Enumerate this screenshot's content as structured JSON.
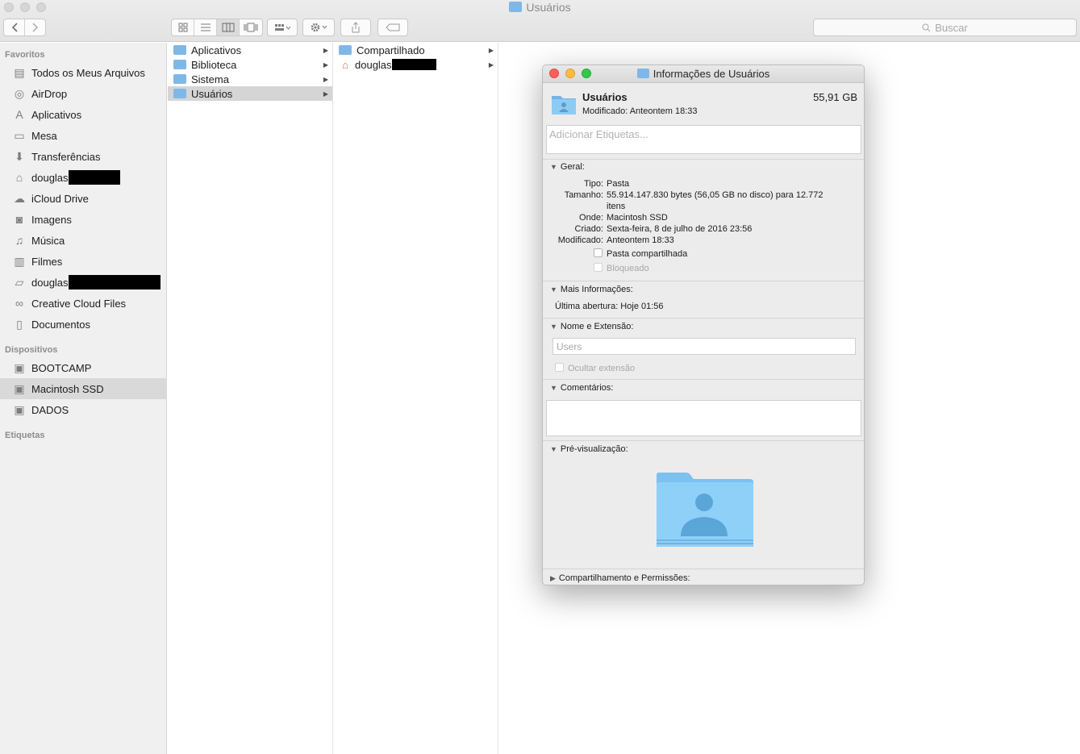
{
  "window": {
    "title": "Usuários"
  },
  "toolbar": {
    "view_icons": [
      "icon-view-icon",
      "list-view-icon",
      "column-view-icon",
      "coverflow-view-icon"
    ],
    "search_placeholder": "Buscar"
  },
  "sidebar": {
    "favorites_header": "Favoritos",
    "favorites": [
      {
        "label": "Todos os Meus Arquivos",
        "icon": "all-files-icon"
      },
      {
        "label": "AirDrop",
        "icon": "airdrop-icon"
      },
      {
        "label": "Aplicativos",
        "icon": "applications-icon"
      },
      {
        "label": "Mesa",
        "icon": "desktop-icon"
      },
      {
        "label": "Transferências",
        "icon": "downloads-icon"
      },
      {
        "label": "douglas",
        "icon": "home-icon"
      },
      {
        "label": "iCloud Drive",
        "icon": "cloud-icon"
      },
      {
        "label": "Imagens",
        "icon": "camera-icon"
      },
      {
        "label": "Música",
        "icon": "music-icon"
      },
      {
        "label": "Filmes",
        "icon": "film-icon"
      },
      {
        "label": "douglas",
        "icon": "folder-icon"
      },
      {
        "label": "Creative Cloud Files",
        "icon": "creative-cloud-icon"
      },
      {
        "label": "Documentos",
        "icon": "document-icon"
      }
    ],
    "devices_header": "Dispositivos",
    "devices": [
      {
        "label": "BOOTCAMP",
        "icon": "disk-icon"
      },
      {
        "label": "Macintosh SSD",
        "icon": "disk-icon"
      },
      {
        "label": "DADOS",
        "icon": "disk-icon"
      }
    ],
    "tags_header": "Etiquetas"
  },
  "columns": {
    "col1": [
      "Aplicativos",
      "Biblioteca",
      "Sistema",
      "Usuários"
    ],
    "col2": [
      "Compartilhado",
      "douglas"
    ]
  },
  "info": {
    "title": "Informações de Usuários",
    "name": "Usuários",
    "size": "55,91 GB",
    "modified_line": "Modificado: Anteontem 18:33",
    "tags_placeholder": "Adicionar Etiquetas...",
    "general": {
      "header": "Geral:",
      "kind_label": "Tipo:",
      "kind": "Pasta",
      "size_label": "Tamanho:",
      "size_line1": "55.914.147.830 bytes (56,05 GB no disco) para 12.772",
      "size_line2": "itens",
      "where_label": "Onde:",
      "where": "Macintosh SSD",
      "created_label": "Criado:",
      "created": "Sexta-feira, 8 de julho de 2016 23:56",
      "modified_label": "Modificado:",
      "modified": "Anteontem 18:33",
      "shared": "Pasta compartilhada",
      "locked": "Bloqueado"
    },
    "more": {
      "header": "Mais Informações:",
      "last_opened": "Última abertura: Hoje 01:56"
    },
    "name_ext": {
      "header": "Nome e Extensão:",
      "value": "Users",
      "hide_ext": "Ocultar extensão"
    },
    "comments": {
      "header": "Comentários:"
    },
    "preview": {
      "header": "Pré-visualização:"
    },
    "sharing": {
      "header": "Compartilhamento e Permissões:"
    }
  }
}
